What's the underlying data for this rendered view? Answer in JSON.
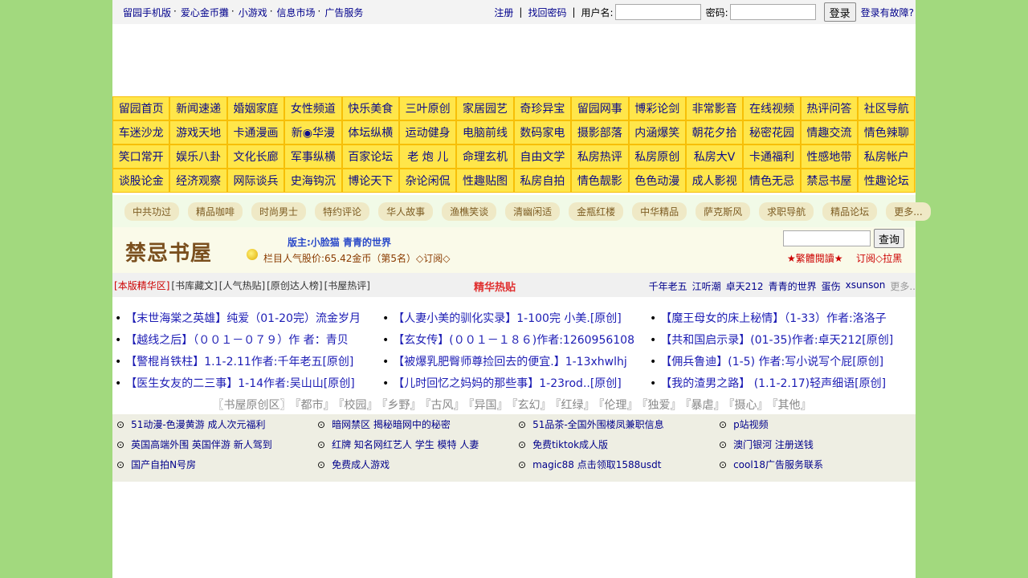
{
  "topbar": {
    "links": [
      "留园手机版",
      "爱心金币攤",
      "小游戏",
      "信息市场",
      "广告服务"
    ],
    "register": "注册",
    "recover": "找回密码",
    "username_label": "用户名:",
    "password_label": "密码:",
    "login_button": "登录",
    "login_trouble": "登录有故障?"
  },
  "nav": [
    [
      "留园首页",
      "新闻速递",
      "婚姻家庭",
      "女性频道",
      "快乐美食",
      "三叶原创",
      "家居园艺",
      "奇珍异宝",
      "留园网事",
      "博彩论剑",
      "非常影音",
      "在线视频",
      "热评问答",
      "社区导航"
    ],
    [
      "车迷沙龙",
      "游戏天地",
      "卡通漫画",
      "新◉华漫",
      "体坛纵横",
      "运动健身",
      "电脑前线",
      "数码家电",
      "摄影部落",
      "内涵爆笑",
      "朝花夕拾",
      "秘密花园",
      "情趣交流",
      "情色辣聊"
    ],
    [
      "笑口常开",
      "娱乐八卦",
      "文化长廊",
      "军事纵横",
      "百家论坛",
      "老 炮 儿",
      "命理玄机",
      "自由文学",
      "私房热评",
      "私房原创",
      "私房大V",
      "卡通福利",
      "性感地带",
      "私房帐户"
    ],
    [
      "谈股论金",
      "经济观察",
      "网际谈兵",
      "史海钩沉",
      "博论天下",
      "杂论闲侃",
      "性趣贴图",
      "私房自拍",
      "情色靓影",
      "色色动漫",
      "成人影视",
      "情色无忌",
      "禁忌书屋",
      "性趣论坛"
    ]
  ],
  "subnav": [
    "中共功过",
    "精品咖啡",
    "时尚男士",
    "特约评论",
    "华人故事",
    "渔樵笑谈",
    "清幽闲适",
    "金瓶红楼",
    "中华精品",
    "萨克斯风",
    "求职导航",
    "精品论坛",
    "更多..."
  ],
  "board": {
    "title": "禁忌书屋",
    "moderators": "版主:小脸猫  青青的世界",
    "price": "栏目人气股价:65.42金币（第5名）◇订阅◇",
    "search_button": "查询",
    "traditional": "★繁體閱讀★",
    "subscribe": "订阅◇拉黑"
  },
  "tabs": {
    "items": [
      "本版精华区",
      "书库藏文",
      "人气热贴",
      "原创达人榜",
      "书屋热评"
    ],
    "hot_label": "精华热贴",
    "authors": [
      "千年老五",
      "江听潮",
      "卓天212",
      "青青的世界",
      "蛋伤",
      "xsunson"
    ],
    "more": "更多.."
  },
  "threads": [
    [
      "【末世海棠之英雄】纯爱（01-20完）流金岁月",
      "【人妻小美的驯化实录】1-100完 小美.[原创]",
      "【魔王母女的床上秘情】（1-33）作者:洛洛子"
    ],
    [
      "【越线之后】（００１－０７９）作 者：青贝",
      "【玄女传】(００１－１８６)作者:1260956108",
      "【共和国启示录】(01-35)作者:卓天212[原创]"
    ],
    [
      "【警棍肖铁柱】1.1-2.11作者:千年老五[原创]",
      "【被爆乳肥臀师尊捡回去的便宜.】1-13xhwlhj",
      "【佣兵鲁迪】(1-5) 作者:写小说写个屁[原创]"
    ],
    [
      "【医生女友的二三事】1-14作者:吴山山[原创]",
      "【儿时回忆之妈妈的那些事】1-23rod..[原创]",
      "【我的渣男之路】 (1.1-2.17)轻声细语[原创]"
    ]
  ],
  "genres": [
    "〖书屋原创区〗",
    "『都市』",
    "『校园』",
    "『乡野』",
    "『古风』",
    "『异国』",
    "『玄幻』",
    "『红绿』",
    "『伦理』",
    "『独爱』",
    "『暴虐』",
    "『摄心』",
    "『其他』"
  ],
  "ads": [
    [
      "51动漫-色漫黄游 成人次元福利",
      "暗网禁区 揭秘暗网中的秘密",
      "51品茶-全国外围楼凤兼职信息",
      "p站视频"
    ],
    [
      "英国高端外围 英国伴游 新人驾到",
      "红牌 知名网红艺人 学生 模特 人妻",
      "免费tiktok成人版",
      "澳门银河 注册送钱"
    ],
    [
      "国产自拍N号房",
      "免费成人游戏",
      "magic88 点击领取1588usdt",
      "cool18广告服务联系"
    ]
  ]
}
